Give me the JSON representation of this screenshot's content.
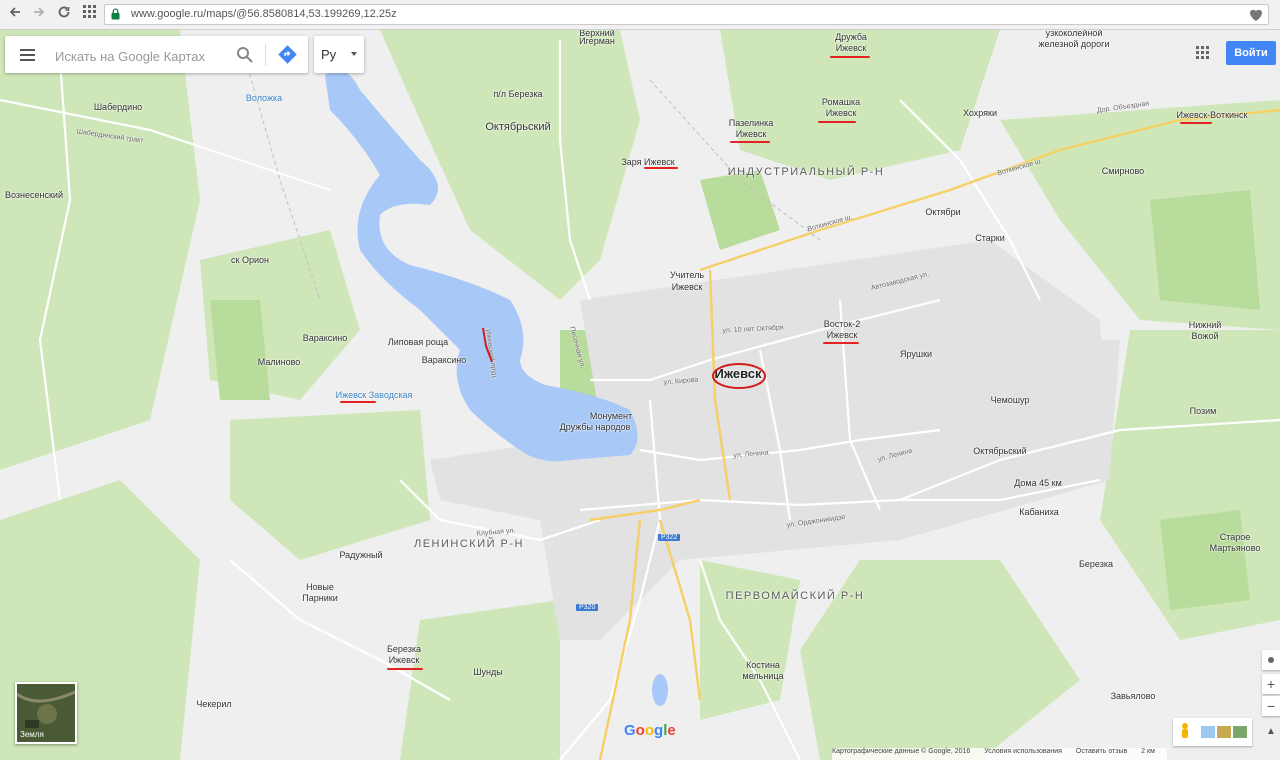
{
  "browser": {
    "url": "www.google.ru/maps/@56.8580814,53.199269,12.25z",
    "back_icon": "arrow-left-icon",
    "forward_icon": "arrow-right-icon",
    "reload_icon": "reload-icon",
    "apps_icon": "apps-grid-icon",
    "bookmark_icon": "heart-icon"
  },
  "search": {
    "placeholder": "Искать на Google Картах"
  },
  "language": {
    "value": "Ру"
  },
  "header": {
    "login_label": "Войти"
  },
  "earth": {
    "label": "Земля"
  },
  "zoom": {
    "in": "+",
    "out": "−"
  },
  "logo": "Google",
  "footer": {
    "data": "Картографические данные © Google, 2016",
    "terms": "Условия использования",
    "feedback": "Оставить отзыв",
    "scale": "2 км"
  },
  "map": {
    "city": "Ижевск",
    "districts": {
      "industrial": "ИНДУСТРИАЛЬНЫЙ Р-Н",
      "leninsky": "ЛЕНИНСКИЙ Р-Н",
      "pervomaisky": "ПЕРВОМАЙСКИЙ Р-Н"
    },
    "places": {
      "igerman_1": "Верхний",
      "igerman_2": "Игерман",
      "druzhba_1": "Дружба",
      "druzhba_2": "Ижевск",
      "railway_1": "узкоколейной",
      "railway_2": "железной дороги",
      "shaberdino": "Шабердино",
      "volozhka": "Воложка",
      "pl_berezka": "п/л Березка",
      "oktyabrsky": "Октябрьский",
      "romashka_1": "Ромашка",
      "romashka_2": "Ижевск",
      "pazelinka_1": "Пазелинка",
      "pazelinka_2": "Ижевск",
      "hohryaki": "Хохряки",
      "votkinsk_stop": "Ижевск-Воткинск",
      "zarya": "Заря Ижевск",
      "voznesensky": "Вознесенский",
      "smirnovo": "Смирново",
      "oktyabri": "Октябри",
      "starki": "Старки",
      "sk_orion": "ск Орион",
      "uchitel_1": "Учитель",
      "uchitel_2": "Ижевск",
      "vostok_1": "Восток-2",
      "vostok_2": "Ижевск",
      "nizhny_1": "Нижний",
      "nizhny_2": "Вожой",
      "varaksino_w": "Вараксино",
      "lipovaya": "Липовая роща",
      "varaksino_e": "Вараксино",
      "malinovo": "Малиново",
      "yarushki": "Ярушки",
      "zavodskaya": "Ижевск Заводская",
      "monument_1": "Монумент",
      "monument_2": "Дружбы народов",
      "chemoshur": "Чемошур",
      "pozim": "Позим",
      "oktyabrsky_e": "Октябрьский",
      "doma45": "Дома 45 км",
      "kabaniha": "Кабаниха",
      "raduzhny": "Радужный",
      "staroe_1": "Старое",
      "staroe_2": "Мартьяново",
      "berezka_e": "Березка",
      "novye_1": "Новые",
      "novye_2": "Парники",
      "berezka_w1": "Березка",
      "berezka_w2": "Ижевск",
      "shundy": "Шунды",
      "kostina_1": "Костина",
      "kostina_2": "мельница",
      "chekeril": "Чекерил",
      "zavyalovo": "Завьялово"
    },
    "roads": {
      "shaberdinsky": "Шабердинский тракт",
      "votkinskoe_1": "Воткинское ш.",
      "votkinskoe_2": "Воткинское ш.",
      "avtozavodskaya": "Автозаводская ул.",
      "kirova": "ул. Кирова",
      "lenina": "ул. Ленина",
      "lenina_e": "ул. Ленина",
      "oktyabrya": "ул. 10 лет Октября",
      "klubnaya": "Клубная ул.",
      "r322": "Р322",
      "r320": "Р320",
      "pesochnaya": "Песочная ул.",
      "ordzhonikidze": "ул. Орджоникидзе",
      "izhevsky_prud": "Ижевский пруд",
      "dor_obyezdnaya": "Дор. Объездная"
    }
  }
}
